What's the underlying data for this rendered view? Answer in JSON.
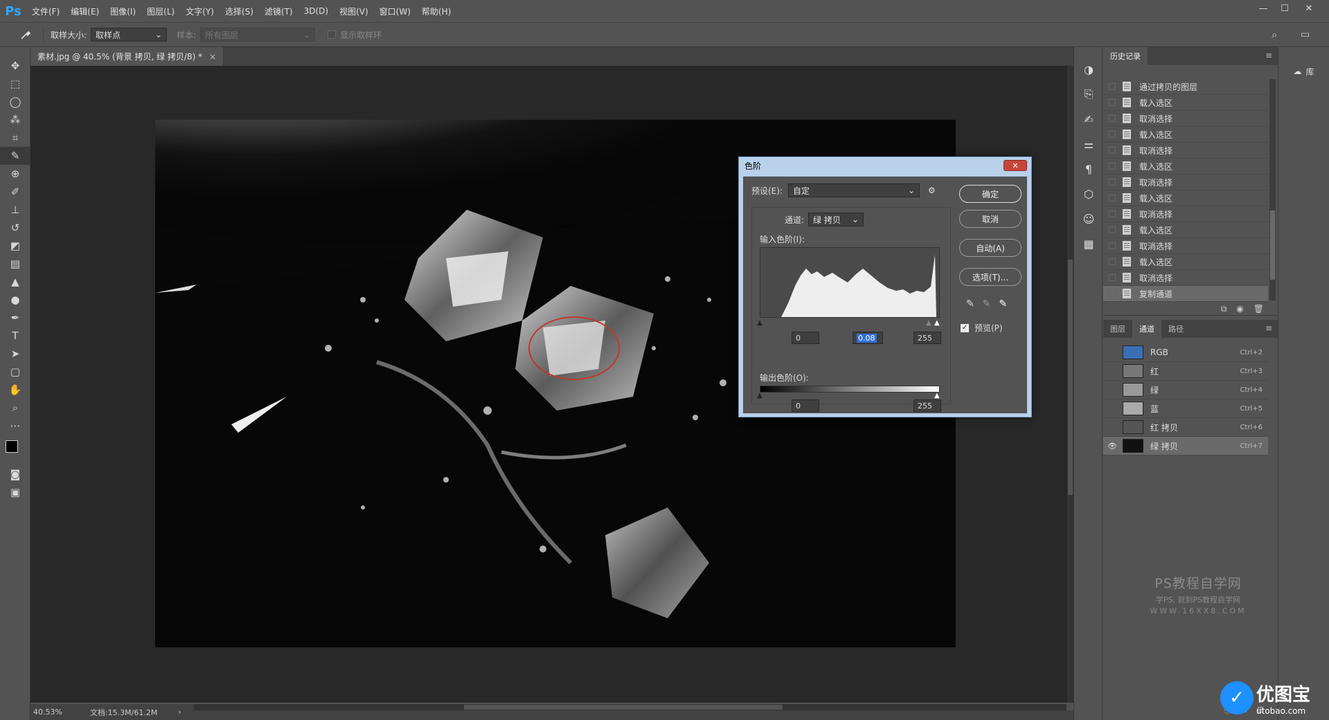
{
  "app": {
    "logo": "Ps",
    "menu": [
      "文件(F)",
      "编辑(E)",
      "图像(I)",
      "图层(L)",
      "文字(Y)",
      "选择(S)",
      "滤镜(T)",
      "3D(D)",
      "视图(V)",
      "窗口(W)",
      "帮助(H)"
    ],
    "window_controls": [
      "—",
      "☐",
      "✕"
    ]
  },
  "options_bar": {
    "sample_size_label": "取样大小:",
    "sample_size_value": "取样点",
    "sample_label": "样本:",
    "sample_value": "所有图层",
    "show_ring_label": "显示取样环"
  },
  "document": {
    "tab_title": "素材.jpg @ 40.5% (背景 拷贝, 绿 拷贝/8) *",
    "close": "×",
    "zoom": "40.53%",
    "doc_size": "文档:15.3M/61.2M",
    "nav_arrow": "›"
  },
  "history_panel": {
    "title": "历史记录",
    "items": [
      "通过拷贝的图层",
      "载入选区",
      "取消选择",
      "载入选区",
      "取消选择",
      "载入选区",
      "取消选择",
      "载入选区",
      "取消选择",
      "载入选区",
      "取消选择",
      "载入选区",
      "取消选择",
      "复制通道"
    ]
  },
  "channels_panel": {
    "tabs": [
      "图层",
      "通道",
      "路径"
    ],
    "channels": [
      {
        "name": "RGB",
        "key": "Ctrl+2"
      },
      {
        "name": "红",
        "key": "Ctrl+3"
      },
      {
        "name": "绿",
        "key": "Ctrl+4"
      },
      {
        "name": "蓝",
        "key": "Ctrl+5"
      },
      {
        "name": "红 拷贝",
        "key": "Ctrl+6"
      },
      {
        "name": "绿 拷贝",
        "key": "Ctrl+7"
      }
    ]
  },
  "library": {
    "label": "库"
  },
  "levels_dialog": {
    "title": "色阶",
    "close": "✕",
    "preset_label": "预设(E):",
    "preset_value": "自定",
    "channel_label": "通道:",
    "channel_value": "绿 拷贝",
    "input_label": "输入色阶(I):",
    "input_black": "0",
    "input_gamma": "0.08",
    "input_white": "255",
    "output_label": "输出色阶(O):",
    "output_black": "0",
    "output_white": "255",
    "btn_ok": "确定",
    "btn_cancel": "取消",
    "btn_auto": "自动(A)",
    "btn_options": "选项(T)...",
    "preview_label": "预览(P)"
  },
  "watermark": {
    "line1": "PS教程自学网",
    "line2": "学PS, 就到PS教程自学网",
    "line3": "WWW.16XX8.COM",
    "brand_name": "优图宝",
    "brand_url": "utobao.com"
  }
}
